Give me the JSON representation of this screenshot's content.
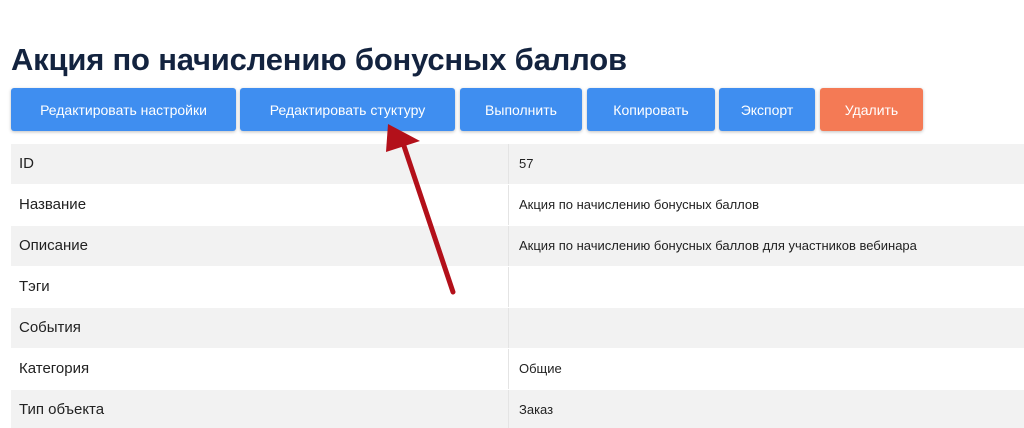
{
  "page": {
    "title": "Акция по начислению бонусных баллов"
  },
  "toolbar": {
    "edit_settings": "Редактировать настройки",
    "edit_structure": "Редактировать стуктуру",
    "execute": "Выполнить",
    "copy": "Копировать",
    "export": "Экспорт",
    "delete": "Удалить"
  },
  "details": [
    {
      "label": "ID",
      "value": "57"
    },
    {
      "label": "Название",
      "value": "Акция по начислению бонусных баллов"
    },
    {
      "label": "Описание",
      "value": "Акция по начислению бонусных баллов для участников вебинара"
    },
    {
      "label": "Тэги",
      "value": ""
    },
    {
      "label": "События",
      "value": ""
    },
    {
      "label": "Категория",
      "value": "Общие"
    },
    {
      "label": "Тип объекта",
      "value": "Заказ"
    }
  ],
  "colors": {
    "primary_button": "#3f8ef0",
    "danger_button": "#f47a55",
    "title_text": "#13233f",
    "annotation_arrow": "#b3101a"
  },
  "annotation": {
    "icon": "red-arrow-icon"
  }
}
